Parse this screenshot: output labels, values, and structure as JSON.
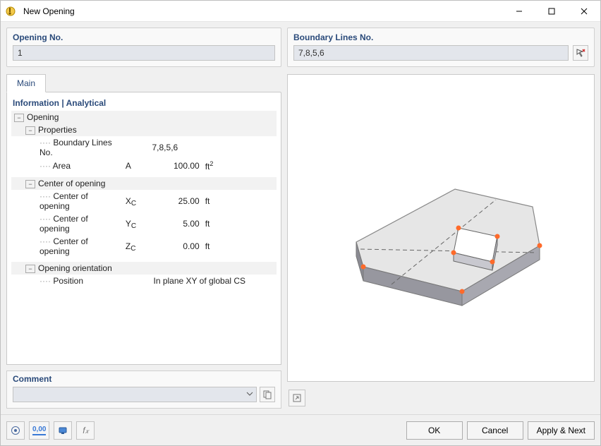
{
  "window": {
    "title": "New Opening"
  },
  "fields": {
    "opening_no": {
      "label": "Opening No.",
      "value": "1"
    },
    "boundary": {
      "label": "Boundary Lines No.",
      "value": "7,8,5,6"
    }
  },
  "tab": {
    "main": "Main"
  },
  "panel": {
    "head": "Information | Analytical"
  },
  "tree": {
    "opening": "Opening",
    "properties": "Properties",
    "boundary_label": "Boundary Lines No.",
    "boundary_val": "7,8,5,6",
    "area_label": "Area",
    "area_sym": "A",
    "area_val": "100.00",
    "area_unit": "ft",
    "area_exp": "2",
    "center_group": "Center of opening",
    "c_xc_label": "Center of opening",
    "c_xc_sym": "X",
    "c_xc_sub": "C",
    "c_xc_val": "25.00",
    "c_xc_unit": "ft",
    "c_yc_label": "Center of opening",
    "c_yc_sym": "Y",
    "c_yc_sub": "C",
    "c_yc_val": "5.00",
    "c_yc_unit": "ft",
    "c_zc_label": "Center of opening",
    "c_zc_sym": "Z",
    "c_zc_sub": "C",
    "c_zc_val": "0.00",
    "c_zc_unit": "ft",
    "orient_group": "Opening orientation",
    "pos_label": "Position",
    "pos_val": "In plane XY of global CS"
  },
  "comment": {
    "head": "Comment",
    "value": ""
  },
  "buttons": {
    "ok": "OK",
    "cancel": "Cancel",
    "apply": "Apply & Next"
  },
  "toolbar": {
    "units": "0,00"
  },
  "tooltips": {
    "select_lines": "Select lines",
    "copy_comment": "Copy",
    "expand_view": "Expand"
  }
}
